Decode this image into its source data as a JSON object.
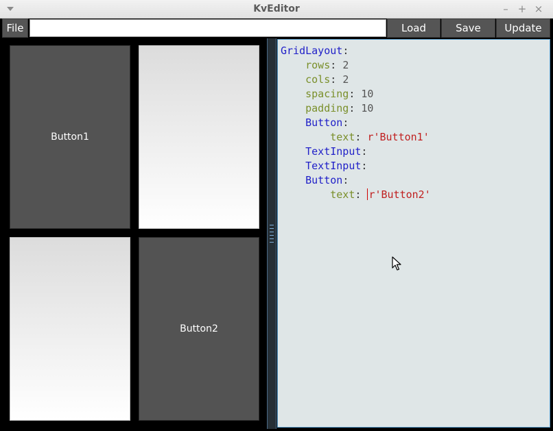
{
  "window": {
    "title": "KvEditor",
    "controls": {
      "minimize": "–",
      "maximize": "+",
      "close": "×"
    }
  },
  "toolbar": {
    "file_label": "File",
    "filename_value": "",
    "load_label": "Load",
    "save_label": "Save",
    "update_label": "Update"
  },
  "preview": {
    "button1_label": "Button1",
    "button2_label": "Button2"
  },
  "editor": {
    "lines": [
      {
        "indent": "",
        "tokens": [
          {
            "t": "GridLayout",
            "c": "kw"
          },
          {
            "t": ":",
            "c": "punct"
          }
        ]
      },
      {
        "indent": "    ",
        "tokens": [
          {
            "t": "rows",
            "c": "prop"
          },
          {
            "t": ": ",
            "c": "punct"
          },
          {
            "t": "2",
            "c": "num"
          }
        ]
      },
      {
        "indent": "    ",
        "tokens": [
          {
            "t": "cols",
            "c": "prop"
          },
          {
            "t": ": ",
            "c": "punct"
          },
          {
            "t": "2",
            "c": "num"
          }
        ]
      },
      {
        "indent": "    ",
        "tokens": [
          {
            "t": "spacing",
            "c": "prop"
          },
          {
            "t": ": ",
            "c": "punct"
          },
          {
            "t": "10",
            "c": "num"
          }
        ]
      },
      {
        "indent": "    ",
        "tokens": [
          {
            "t": "padding",
            "c": "prop"
          },
          {
            "t": ": ",
            "c": "punct"
          },
          {
            "t": "10",
            "c": "num"
          }
        ]
      },
      {
        "indent": "    ",
        "tokens": [
          {
            "t": "Button",
            "c": "kw"
          },
          {
            "t": ":",
            "c": "punct"
          }
        ]
      },
      {
        "indent": "        ",
        "tokens": [
          {
            "t": "text",
            "c": "prop"
          },
          {
            "t": ": ",
            "c": "punct"
          },
          {
            "t": "r'Button1'",
            "c": "str"
          }
        ]
      },
      {
        "indent": "    ",
        "tokens": [
          {
            "t": "TextInput",
            "c": "kw"
          },
          {
            "t": ":",
            "c": "punct"
          }
        ]
      },
      {
        "indent": "    ",
        "tokens": [
          {
            "t": "TextInput",
            "c": "kw"
          },
          {
            "t": ":",
            "c": "punct"
          }
        ]
      },
      {
        "indent": "    ",
        "tokens": [
          {
            "t": "Button",
            "c": "kw"
          },
          {
            "t": ":",
            "c": "punct"
          }
        ]
      },
      {
        "indent": "        ",
        "tokens": [
          {
            "t": "text",
            "c": "prop"
          },
          {
            "t": ": ",
            "c": "punct"
          },
          {
            "t": "|caret|",
            "c": "caret"
          },
          {
            "t": "r'Button2'",
            "c": "str"
          }
        ]
      }
    ]
  },
  "colors": {
    "keyword": "#1f1fc8",
    "property": "#7a8f2a",
    "string": "#c02020",
    "button_bg": "#535353",
    "editor_bg": "#dfe6e7"
  }
}
